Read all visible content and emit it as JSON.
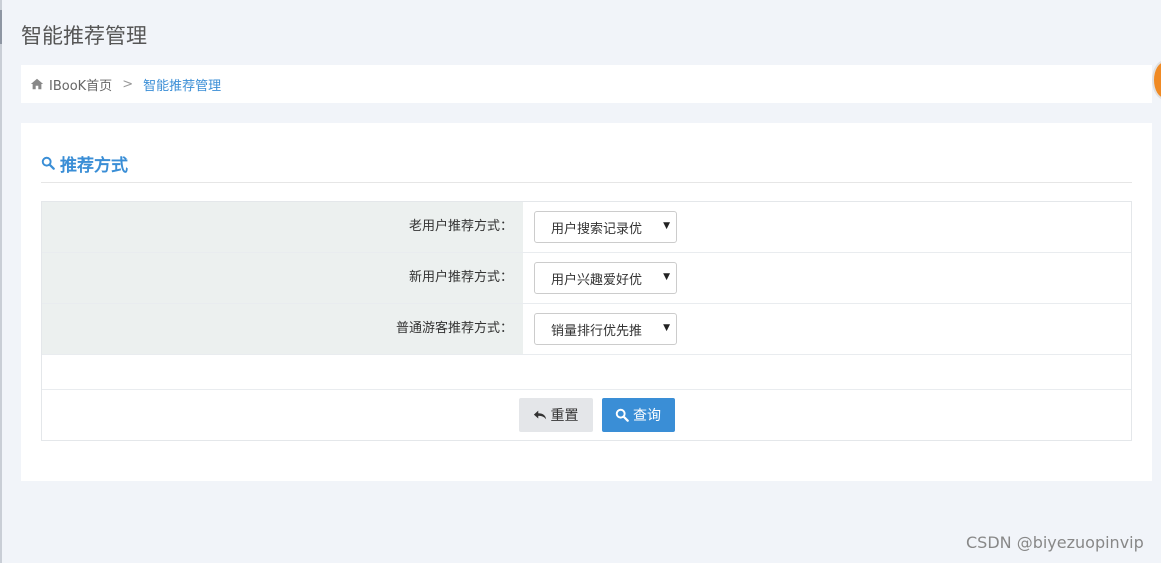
{
  "page": {
    "title": "智能推荐管理"
  },
  "breadcrumb": {
    "home_icon": "home-icon",
    "home": "IBooK首页",
    "separator": ">",
    "current": "智能推荐管理"
  },
  "panel": {
    "header_icon": "search-icon",
    "header": "推荐方式",
    "rows": [
      {
        "label": "老用户推荐方式：",
        "value": "用户搜索记录优"
      },
      {
        "label": "新用户推荐方式：",
        "value": "用户兴趣爱好优"
      },
      {
        "label": "普通游客推荐方式：",
        "value": "销量排行优先推"
      }
    ],
    "reset_label": "重置",
    "reset_icon": "undo-icon",
    "query_label": "查询",
    "query_icon": "search-icon"
  },
  "watermark": "CSDN @biyezuopinvip",
  "colors": {
    "accent": "#3a8ed6",
    "label_bg": "#ecf0ef",
    "page_bg": "#f1f4f9"
  }
}
